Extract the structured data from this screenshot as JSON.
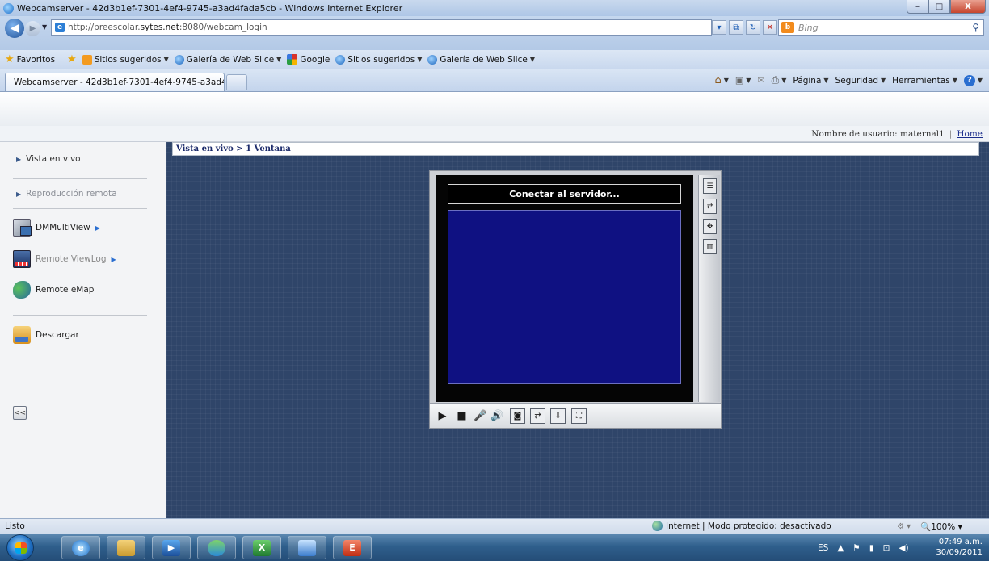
{
  "window": {
    "title": "Webcamserver - 42d3b1ef-7301-4ef4-9745-a3ad4fada5cb - Windows Internet Explorer",
    "buttons": {
      "minimize": "–",
      "maximize": "□",
      "close": "X"
    }
  },
  "address": {
    "url_prefix": "http://preescolar.",
    "url_domain": "sytes.net",
    "url_suffix": ":8080/webcam_login",
    "search_placeholder": "Bing"
  },
  "favorites": {
    "label": "Favoritos",
    "items": [
      "Sitios sugeridos",
      "Galería de Web Slice",
      "Google",
      "Sitios sugeridos",
      "Galería de Web Slice"
    ]
  },
  "tab": {
    "label": "Webcamserver - 42d3b1ef-7301-4ef4-9745-a3ad4...",
    "commands": [
      "Página",
      "Seguridad",
      "Herramientas"
    ]
  },
  "userbar": {
    "user_label": "Nombre de usuario: maternal1",
    "home_link": "Home"
  },
  "sidebar": {
    "live_view": "Vista en vivo",
    "remote_playback": "Reproducción remota",
    "tools": [
      {
        "label": "DMMultiView",
        "icon": "dmmultiview-icon"
      },
      {
        "label": "Remote ViewLog",
        "icon": "remote-viewlog-icon"
      },
      {
        "label": "Remote eMap",
        "icon": "remote-emap-icon"
      }
    ],
    "download": "Descargar",
    "collapse": "<<"
  },
  "main": {
    "breadcrumb": "Vista en vivo > 1 Ventana"
  },
  "player": {
    "status": "Conectar al servidor...",
    "side_tools": [
      "list-icon",
      "window-switch-icon",
      "ptz-icon",
      "layout-icon"
    ],
    "controls": [
      "play-icon",
      "stop-icon",
      "microphone-icon",
      "speaker-icon",
      "snapshot-icon",
      "switch-window-icon",
      "save-icon",
      "fullscreen-icon"
    ]
  },
  "statusbar": {
    "text": "Listo",
    "zone": "Internet | Modo protegido: desactivado",
    "zoom": "100%"
  },
  "taskbar": {
    "language": "ES",
    "time": "07:49 a.m.",
    "date": "30/09/2011"
  }
}
